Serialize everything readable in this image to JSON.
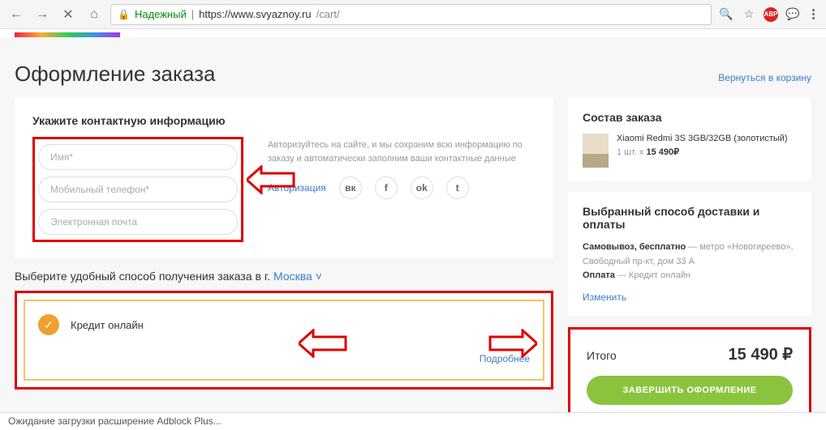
{
  "browser": {
    "secure_label": "Надежный",
    "url_host": "https://www.svyaznoy.ru",
    "url_path": "/cart/",
    "abp_label": "ABP",
    "status_text": "Ожидание загрузки расширение Adblock Plus..."
  },
  "header": {
    "title": "Оформление заказа",
    "back_link": "Вернуться в корзину"
  },
  "contact": {
    "section_title": "Укажите контактную информацию",
    "name_placeholder": "Имя*",
    "phone_placeholder": "Мобильный телефон*",
    "email_placeholder": "Электронная почта",
    "info_text": "Авторизуйтесь на сайте, и мы сохраним всю информацию по заказу и автоматически заполним ваши контактные данные",
    "auth_label": "Авторизация",
    "social_vk": "вк",
    "social_fb": "f",
    "social_ok": "ok",
    "social_tw": "t"
  },
  "delivery": {
    "prefix": "Выберите удобный способ получения заказа в г.",
    "city": "Москва",
    "credit_label": "Кредит онлайн",
    "details_link": "Подробнее"
  },
  "order": {
    "title": "Состав заказа",
    "item_name": "Xiaomi Redmi 3S 3GB/32GB (золотистый)",
    "item_qty_prefix": "1 шт. х ",
    "item_price": "15 490₽",
    "delivery_title": "Выбранный способ доставки и оплаты",
    "pickup_label": "Самовывоз, бесплатно",
    "pickup_addr": " — метро «Новогиреево», Свободный пр-кт, дом 33 А",
    "payment_label": "Оплата",
    "payment_value": " — Кредит онлайн",
    "change_link": "Изменить",
    "total_label": "Итого",
    "total_price": "15 490",
    "total_currency": "₽",
    "complete_btn": "ЗАВЕРШИТЬ ОФОРМЛЕНИЕ"
  }
}
